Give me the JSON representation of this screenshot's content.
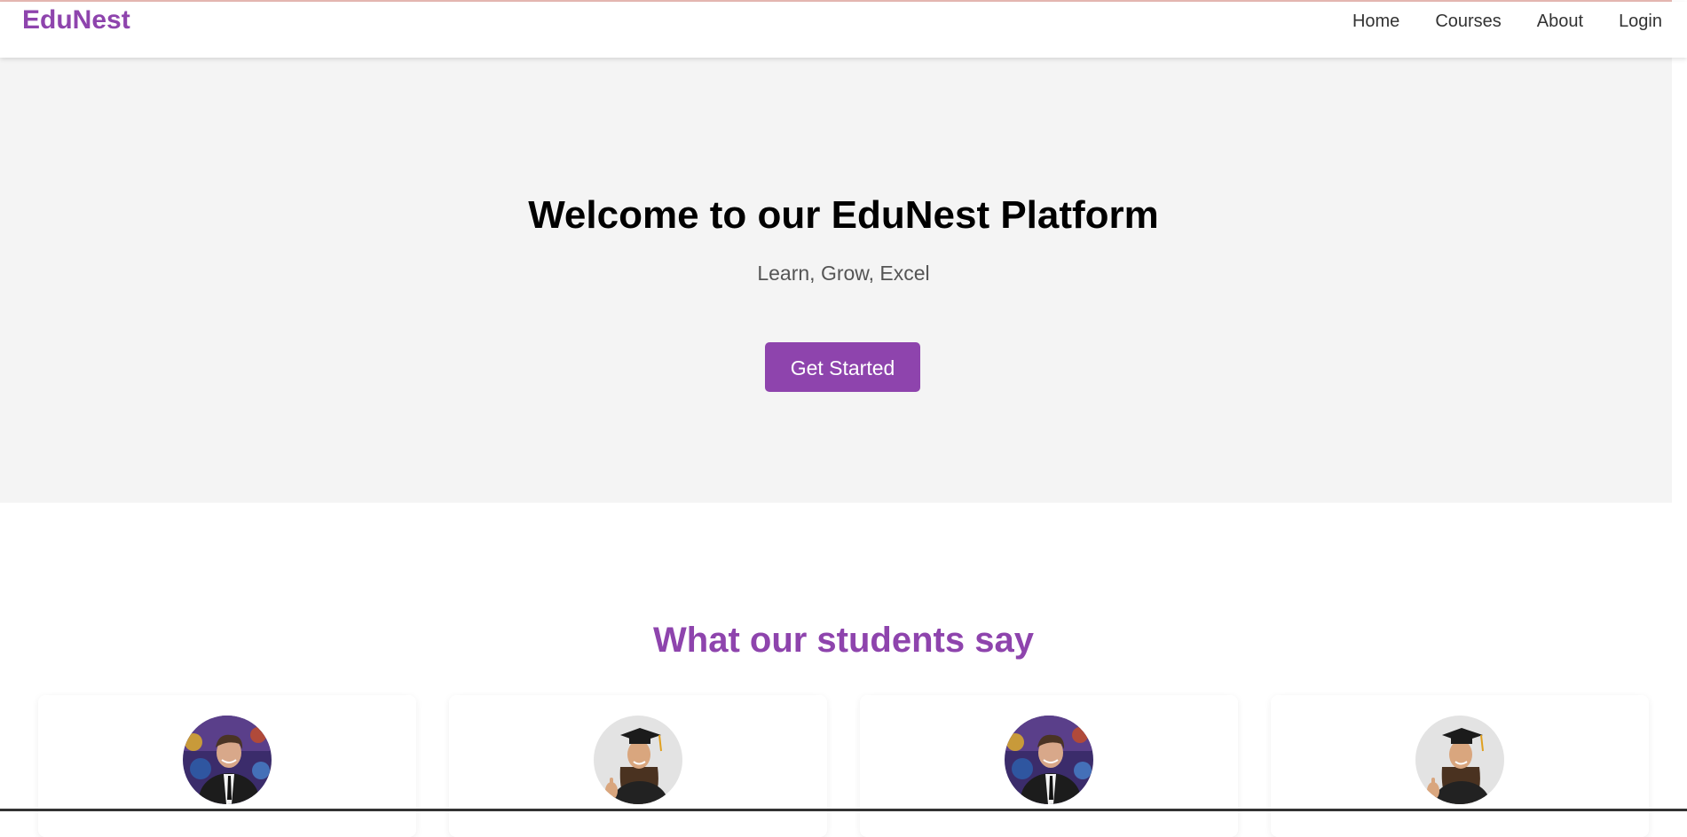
{
  "header": {
    "logo": "EduNest",
    "nav": [
      "Home",
      "Courses",
      "About",
      "Login"
    ]
  },
  "hero": {
    "title": "Welcome to our EduNest Platform",
    "subtitle": "Learn, Grow, Excel",
    "cta_label": "Get Started"
  },
  "testimonials": {
    "title": "What our students say",
    "cards": [
      {
        "avatar": "male-student-photo"
      },
      {
        "avatar": "female-graduate-photo"
      },
      {
        "avatar": "male-student-photo"
      },
      {
        "avatar": "female-graduate-photo"
      }
    ]
  },
  "colors": {
    "brand": "#8e44ad",
    "hero_bg": "#f4f4f4",
    "nav_text": "#333333"
  }
}
